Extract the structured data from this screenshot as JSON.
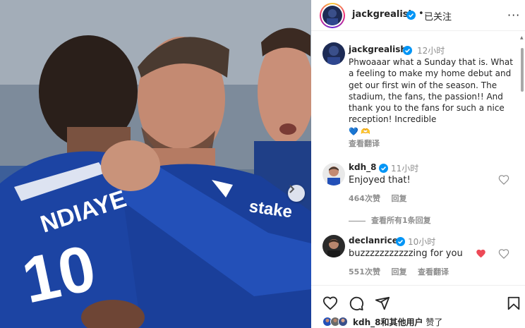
{
  "photo": {
    "jersey_name": "NDIAYE",
    "jersey_number": "10",
    "sponsor": "stake"
  },
  "header": {
    "username": "jackgrealish",
    "separator": "•",
    "follow_status": "已关注",
    "more": "···"
  },
  "caption": {
    "username": "jackgrealish",
    "time": "12小时",
    "text": "Phwoaaar what a Sunday that is. What a feeling to make my home debut and get our first win of the season. The stadium, the fans, the passion!! And thank you to the fans for such a nice reception!  Incredible",
    "emojis": "💙 🫶",
    "translate": "查看翻译"
  },
  "comments": [
    {
      "username": "kdh_8",
      "time": "11小时",
      "text": "Enjoyed that!",
      "likes": "464次赞",
      "reply": "回复"
    },
    {
      "username": "declanrice",
      "time": "10小时",
      "text": "buzzzzzzzzzzzing for you",
      "emoji": "❤",
      "likes": "551次赞",
      "reply": "回复",
      "translate": "查看翻译"
    }
  ],
  "view_replies": "查看所有1条回复",
  "likes_bar": {
    "user": "kdh_8",
    "joiner": "和",
    "others": "其他用户",
    "suffix": "赞了"
  },
  "colors": {
    "verified": "#0095f6",
    "heart_red": "#ed4956",
    "muted": "#8e8e8e"
  },
  "icons": [
    "heart-icon",
    "comment-icon",
    "share-icon",
    "bookmark-icon",
    "chevron-right-icon",
    "verified-icon"
  ]
}
